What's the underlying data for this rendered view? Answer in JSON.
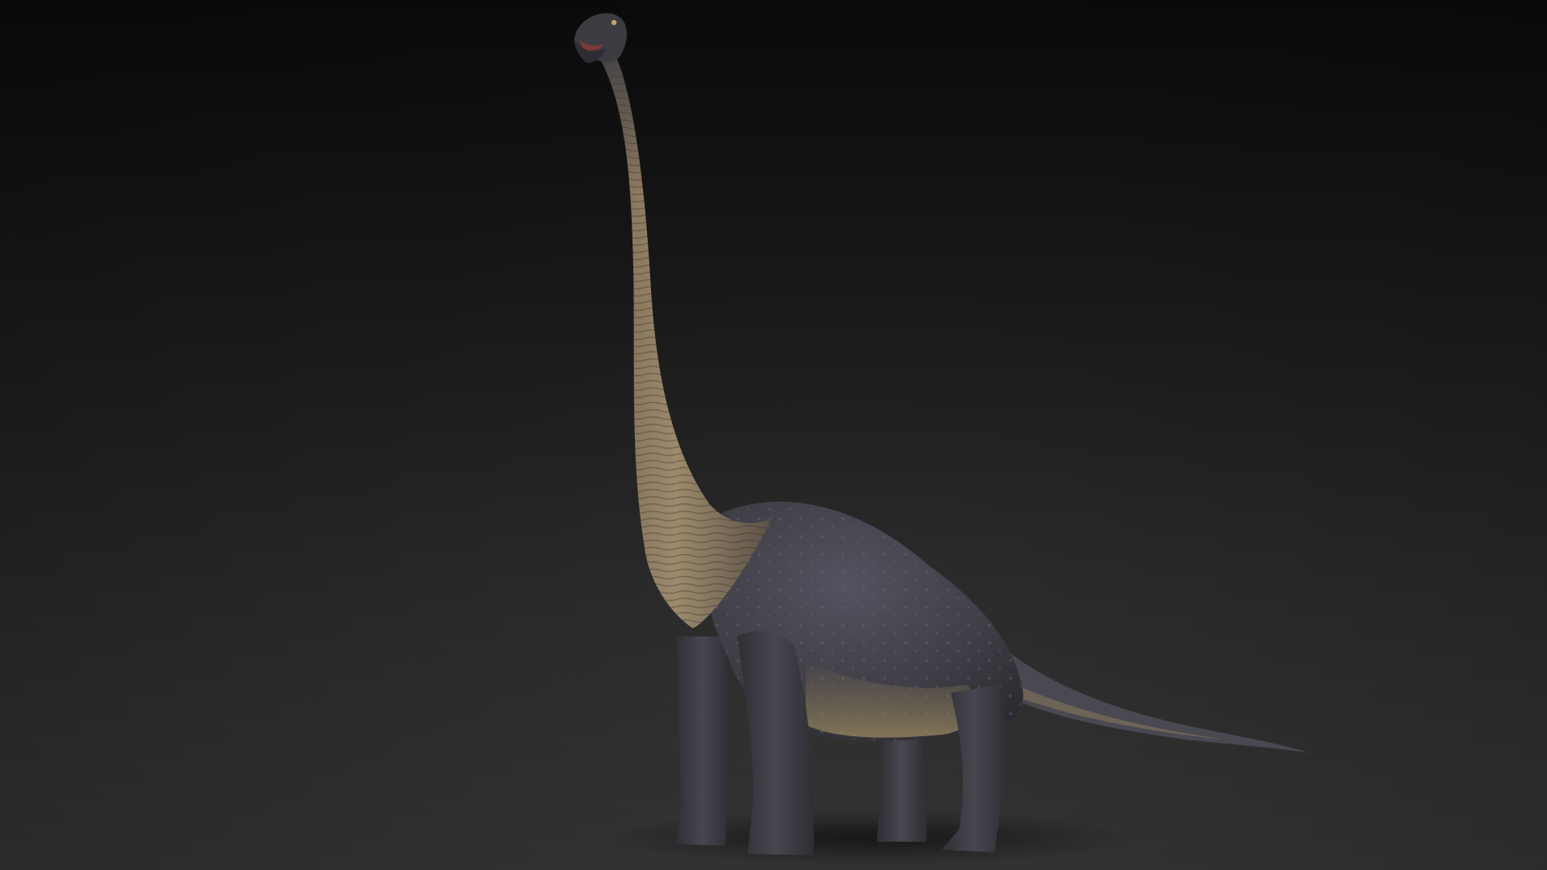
{
  "scene": {
    "subject_icon": "brachiosaurus-icon",
    "colors": {
      "background_top": "#0f0f0f",
      "background_bottom": "#3a3a3a",
      "skin_dark": "#3c3b42",
      "skin_mid": "#4a4850",
      "neck_light": "#9c8a6c",
      "neck_mid": "#7a6a55",
      "belly": "#8a7c5c",
      "shadow": "#1b1b1b"
    }
  }
}
